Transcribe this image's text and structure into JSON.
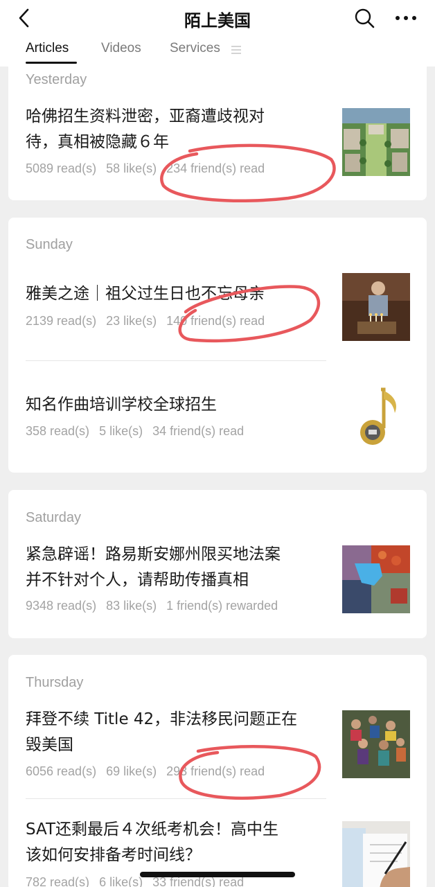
{
  "header": {
    "title": "陌上美国",
    "tabs": [
      "Articles",
      "Videos",
      "Services"
    ]
  },
  "groups": [
    {
      "day": "Yesterday",
      "articles": [
        {
          "title_line1": "哈佛招生资料泄密，亚裔遭歧视对",
          "title_line2": "待，真相被隐藏６年",
          "reads": "5089 read(s)",
          "likes": "58 like(s)",
          "extra": "234 friend(s) read",
          "thumbnail": "campus-aerial-photo",
          "circled": true
        }
      ]
    },
    {
      "day": "Sunday",
      "articles": [
        {
          "title_line1": "雅美之途｜祖父过生日也不忘母亲",
          "title_line2": "",
          "reads": "2139 read(s)",
          "likes": "23 like(s)",
          "extra": "140 friend(s) read",
          "thumbnail": "birthday-photo",
          "circled": true
        },
        {
          "title_line1": "知名作曲培训学校全球招生",
          "title_line2": "",
          "reads": "358 read(s)",
          "likes": "5 like(s)",
          "extra": "34 friend(s) read",
          "thumbnail": "gold-music-note-logo",
          "circled": false
        }
      ]
    },
    {
      "day": "Saturday",
      "articles": [
        {
          "title_line1": "紧急辟谣！路易斯安娜州限买地法案",
          "title_line2": "并不针对个人，请帮助传播真相",
          "reads": "9348 read(s)",
          "likes": "83 like(s)",
          "extra": "1 friend(s) rewarded",
          "thumbnail": "louisiana-collage",
          "circled": false
        }
      ]
    },
    {
      "day": "Thursday",
      "articles": [
        {
          "title_line1": "拜登不续 Title 42，非法移民问题正在",
          "title_line2": "毁美国",
          "reads": "6056 read(s)",
          "likes": "69 like(s)",
          "extra": "293 friend(s) read",
          "thumbnail": "crowd-photo",
          "circled": true
        },
        {
          "title_line1": "SAT还剩最后４次纸考机会！高中生",
          "title_line2": "该如何安排备考时间线？",
          "reads": "782 read(s)",
          "likes": "6 like(s)",
          "extra": "33 friend(s) read",
          "thumbnail": "sat-study-photo",
          "circled": false
        }
      ]
    }
  ],
  "colors": {
    "accent": "#111111",
    "muted": "#a3a3a3",
    "annotation": "#e8585c",
    "background": "#efefef"
  }
}
